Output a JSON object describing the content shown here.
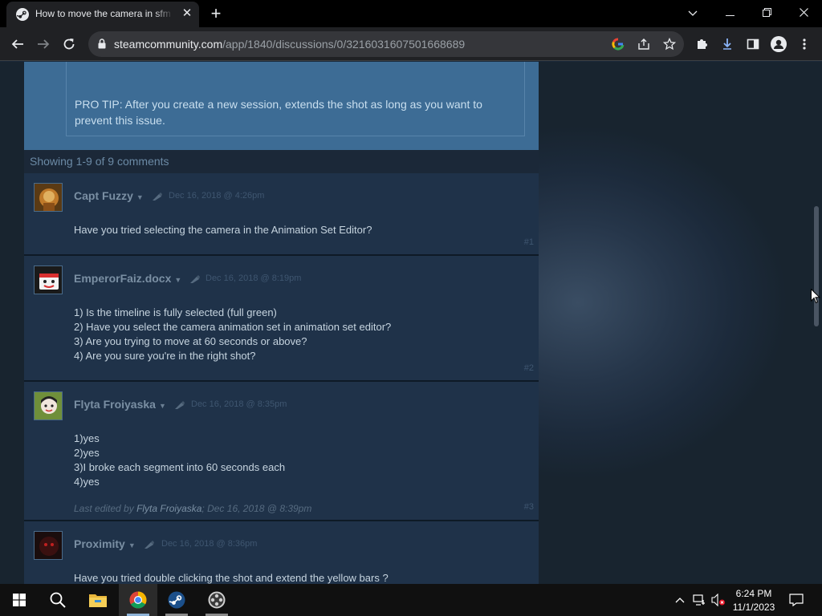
{
  "browser": {
    "tab_title": "How to move the camera in sfm",
    "url_host": "steamcommunity.com",
    "url_path": "/app/1840/discussions/0/3216031607501668689"
  },
  "thread": {
    "op_tip": "PRO TIP: After you create a new session, extends the shot as long as you want to prevent this issue.",
    "comments_count": "Showing 1-9 of 9 comments"
  },
  "comments": [
    {
      "author": "Capt Fuzzy",
      "date": "Dec 16, 2018 @ 4:26pm",
      "lines": [
        "Have you tried selecting the camera in the Animation Set Editor?"
      ],
      "number": "#1"
    },
    {
      "author": "EmperorFaiz.docx",
      "date": "Dec 16, 2018 @ 8:19pm",
      "lines": [
        "1) Is the timeline is fully selected (full green)",
        "2) Have you select the camera animation set in animation set editor?",
        "3) Are you trying to move at 60 seconds or above?",
        "4) Are you sure you're in the right shot?"
      ],
      "number": "#2"
    },
    {
      "author": "Flyta Froiyaska",
      "date": "Dec 16, 2018 @ 8:35pm",
      "lines": [
        "1)yes",
        "2)yes",
        "3)I broke each segment into 60 seconds each",
        "4)yes"
      ],
      "edited_prefix": "Last edited by",
      "edited_author": "Flyta Froiyaska",
      "edited_date": "; Dec 16, 2018 @ 8:39pm",
      "number": "#3"
    },
    {
      "author": "Proximity",
      "date": "Dec 16, 2018 @ 8:36pm",
      "lines": [
        "Have you tried double clicking the shot and extend the yellow bars ?"
      ]
    }
  ],
  "taskbar": {
    "time": "6:24 PM",
    "date": "11/1/2023"
  }
}
